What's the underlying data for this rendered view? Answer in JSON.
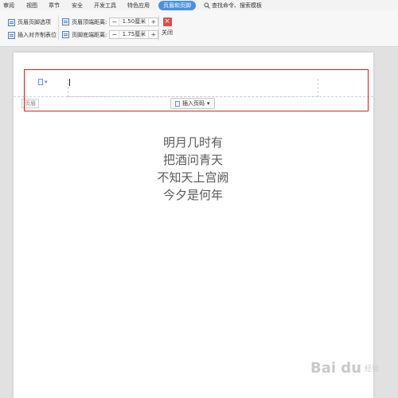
{
  "tabs": [
    "审阅",
    "视图",
    "章节",
    "安全",
    "开发工具",
    "特色应用",
    "页眉和页脚",
    "查找命令、搜索模板"
  ],
  "toolbar": {
    "header_footer_options": "页眉页脚选项",
    "insert_align_tab": "插入对齐制表位",
    "header_top_label": "页眉顶端距离:",
    "header_top_value": "1.50厘米",
    "footer_bottom_label": "页脚底端距离:",
    "footer_bottom_value": "1.75厘米",
    "minus": "−",
    "plus": "+",
    "close_label": "关闭",
    "close_icon": "×"
  },
  "document": {
    "header_tag": "页眉",
    "insert_page_number": "插入页码",
    "insert_dropdown": "▾",
    "page_icon_dropdown": "▾"
  },
  "poem": [
    "明月几时有",
    "把酒问青天",
    "不知天上宫阙",
    "今夕是何年"
  ],
  "watermark": {
    "logo": "Bai du",
    "sub": "经验"
  },
  "colors": {
    "active_tab": "#4a8fe0",
    "close_red": "#e14b4b",
    "highlight_box": "#c2272d"
  }
}
